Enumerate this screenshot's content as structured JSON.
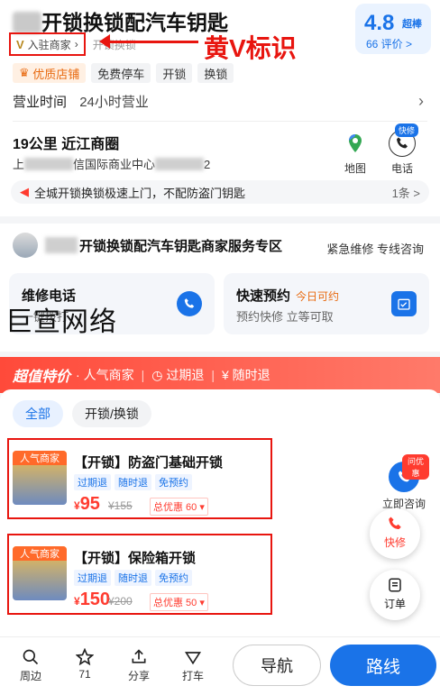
{
  "header": {
    "title_suffix": "开锁换锁配汽车钥匙",
    "rating": "4.8",
    "rating_badge": "超棒",
    "reviews": "66 评价 >"
  },
  "merchant": {
    "v_mark": "V",
    "label": "入驻商家",
    "category": "开锁换锁"
  },
  "annotation": "黄V标识",
  "tags": [
    "优质店铺",
    "免费停车",
    "开锁",
    "换锁"
  ],
  "hours": {
    "label": "营业时间",
    "value": "24小时营业"
  },
  "location": {
    "distance": "19公里  近江商圈",
    "address_part1": "上",
    "address_part2": "信国际商业中心",
    "address_part3": "2"
  },
  "actions": {
    "map": "地图",
    "phone": "电话",
    "phone_badge": "快修"
  },
  "notice": {
    "text": "全城开锁换锁极速上门，不配防盗门钥匙",
    "count": "1条 >"
  },
  "zone": {
    "title": "开锁换锁配汽车钥匙商家服务专区",
    "subtitle": "紧急维修 专线咨询"
  },
  "services": {
    "repair": {
      "title": "维修电话",
      "desc": "一键拨打"
    },
    "booking": {
      "title": "快速预约",
      "today": "今日可约",
      "desc": "预约快修 立等可取"
    }
  },
  "watermark": "巨宣网络",
  "deals": {
    "header_big": "超值特价",
    "header_items": [
      "· 人气商家",
      "过期退",
      "随时退"
    ],
    "filters": [
      "全部",
      "开锁/换锁"
    ],
    "items": [
      {
        "label": "人气商家",
        "name": "【开锁】防盗门基础开锁",
        "chips": [
          "过期退",
          "随时退",
          "免预约"
        ],
        "price": "95",
        "orig": "¥155",
        "save": "总优惠 60 ▾"
      },
      {
        "label": "人气商家",
        "name": "【开锁】保险箱开锁",
        "chips": [
          "过期退",
          "随时退",
          "免预约"
        ],
        "price": "150",
        "orig": "¥200",
        "save": "总优惠 50 ▾"
      }
    ],
    "consult": {
      "label": "立即咨询",
      "badge": "问优惠"
    }
  },
  "floats": {
    "quick": "快修",
    "order": "订单"
  },
  "bottom": {
    "nearby": "周边",
    "fav": "71",
    "share": "分享",
    "taxi": "打车",
    "nav": "导航",
    "route": "路线"
  },
  "colors": {
    "accent": "#1a73e8",
    "red": "#e8150f",
    "price": "#ff3b2f"
  }
}
